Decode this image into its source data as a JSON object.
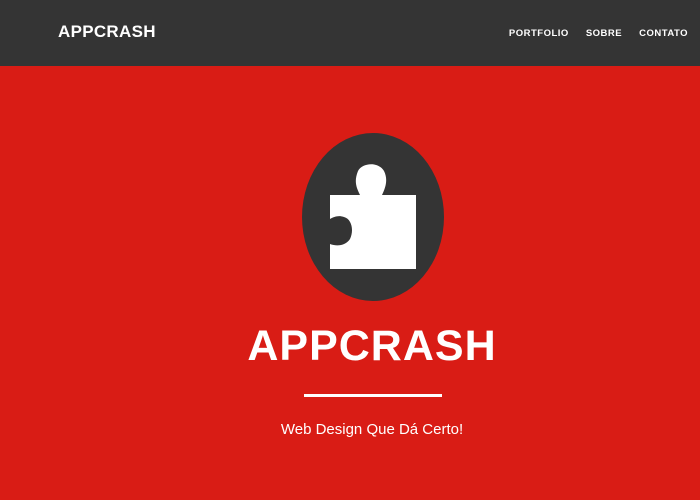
{
  "navbar": {
    "brand": "APPCRASH",
    "links": [
      {
        "label": "PORTFOLIO"
      },
      {
        "label": "SOBRE"
      },
      {
        "label": "CONTATO"
      }
    ]
  },
  "hero": {
    "logo_icon": "puzzle-piece-icon",
    "title": "APPCRASH",
    "tagline": "Web Design Que Dá Certo!"
  },
  "colors": {
    "navbar_bg": "#343434",
    "hero_bg": "#d91c15",
    "logo_circle": "#343434",
    "text": "#ffffff"
  }
}
